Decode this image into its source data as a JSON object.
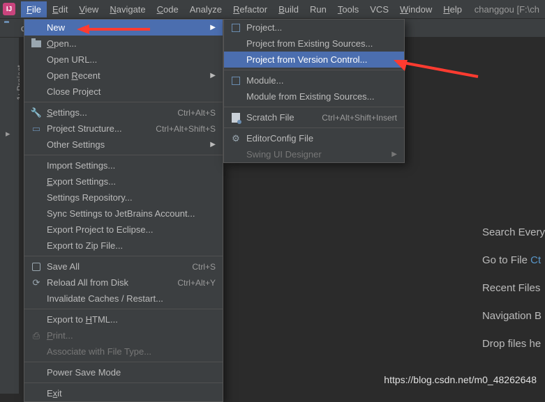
{
  "right_info": "changgou [F:\\ch",
  "menubar": [
    {
      "label": "File",
      "u": "F",
      "open": true
    },
    {
      "label": "Edit",
      "u": "E"
    },
    {
      "label": "View",
      "u": "V"
    },
    {
      "label": "Navigate",
      "u": "N"
    },
    {
      "label": "Code",
      "u": "C"
    },
    {
      "label": "Analyze"
    },
    {
      "label": "Refactor",
      "u": "R"
    },
    {
      "label": "Build",
      "u": "B"
    },
    {
      "label": "Run"
    },
    {
      "label": "Tools",
      "u": "T"
    },
    {
      "label": "VCS"
    },
    {
      "label": "Window",
      "u": "W"
    },
    {
      "label": "Help",
      "u": "H"
    }
  ],
  "toolbar_crumb": "c",
  "sidebar": {
    "project_tab": "1: Project",
    "u": "1"
  },
  "file_menu": [
    {
      "type": "item",
      "label": "New",
      "selected": true,
      "submenu": true
    },
    {
      "type": "item",
      "label": "Open...",
      "u": "O",
      "icon": "folder-open"
    },
    {
      "type": "item",
      "label": "Open URL..."
    },
    {
      "type": "item",
      "label": "Open Recent",
      "u": "R",
      "submenu": true
    },
    {
      "type": "item",
      "label": "Close Project"
    },
    {
      "type": "sep"
    },
    {
      "type": "item",
      "label": "Settings...",
      "u": "S",
      "icon": "wrench",
      "shortcut": "Ctrl+Alt+S"
    },
    {
      "type": "item",
      "label": "Project Structure...",
      "icon": "struct",
      "shortcut": "Ctrl+Alt+Shift+S"
    },
    {
      "type": "item",
      "label": "Other Settings",
      "submenu": true
    },
    {
      "type": "sep"
    },
    {
      "type": "item",
      "label": "Import Settings..."
    },
    {
      "type": "item",
      "label": "Export Settings...",
      "u": "E"
    },
    {
      "type": "item",
      "label": "Settings Repository..."
    },
    {
      "type": "item",
      "label": "Sync Settings to JetBrains Account..."
    },
    {
      "type": "item",
      "label": "Export Project to Eclipse..."
    },
    {
      "type": "item",
      "label": "Export to Zip File..."
    },
    {
      "type": "sep"
    },
    {
      "type": "item",
      "label": "Save All",
      "icon": "save",
      "shortcut": "Ctrl+S"
    },
    {
      "type": "item",
      "label": "Reload All from Disk",
      "icon": "reload",
      "shortcut": "Ctrl+Alt+Y"
    },
    {
      "type": "item",
      "label": "Invalidate Caches / Restart..."
    },
    {
      "type": "sep"
    },
    {
      "type": "item",
      "label": "Export to HTML...",
      "u": "H"
    },
    {
      "type": "item",
      "label": "Print...",
      "u": "P",
      "icon": "print",
      "disabled": true
    },
    {
      "type": "item",
      "label": "Associate with File Type...",
      "disabled": true
    },
    {
      "type": "sep"
    },
    {
      "type": "item",
      "label": "Power Save Mode"
    },
    {
      "type": "sep"
    },
    {
      "type": "item",
      "label": "Exit",
      "u": "x"
    }
  ],
  "new_menu": [
    {
      "type": "item",
      "label": "Project...",
      "icon": "box"
    },
    {
      "type": "item",
      "label": "Project from Existing Sources..."
    },
    {
      "type": "item",
      "label": "Project from Version Control...",
      "selected": true
    },
    {
      "type": "sep"
    },
    {
      "type": "item",
      "label": "Module...",
      "icon": "box"
    },
    {
      "type": "item",
      "label": "Module from Existing Sources..."
    },
    {
      "type": "sep"
    },
    {
      "type": "item",
      "label": "Scratch File",
      "icon": "scratch",
      "shortcut": "Ctrl+Alt+Shift+Insert"
    },
    {
      "type": "sep"
    },
    {
      "type": "item",
      "label": "EditorConfig File",
      "icon": "gear"
    },
    {
      "type": "item",
      "label": "Swing UI Designer",
      "disabled": true,
      "submenu": true
    }
  ],
  "welcome": {
    "l1": "Search Every",
    "l2a": "Go to File ",
    "l2b": "Ct",
    "l3": "Recent Files",
    "l4": "Navigation B",
    "l5": "Drop files he"
  },
  "watermark": "https://blog.csdn.net/m0_48262648"
}
